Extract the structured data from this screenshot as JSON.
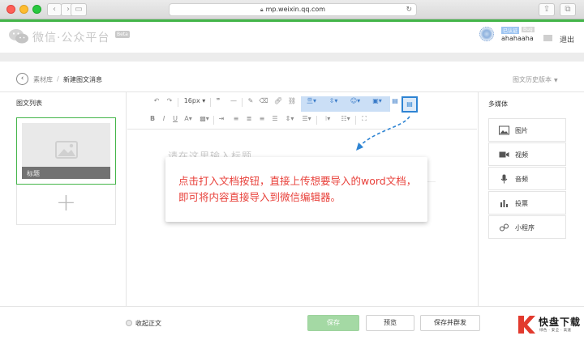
{
  "browser": {
    "url": "mp.weixin.qq.com"
  },
  "header": {
    "title": "微信·公众平台",
    "beta": "Beta",
    "account_name": "ahahaaha",
    "account_badge_1": "已认证",
    "account_badge_2": "Bug",
    "logout_label": "退出"
  },
  "breadcrumb": {
    "library": "素材库",
    "separator": "/",
    "current": "新建图文消息",
    "history_label": "图文历史版本"
  },
  "article_list": {
    "title": "图文列表",
    "items": [
      {
        "title": "标题"
      }
    ],
    "add_symbol": "+"
  },
  "toolbar": {
    "font_size": "16px",
    "doc_import_tooltip": "打入文档"
  },
  "editor": {
    "title_placeholder": "请在这里输入标题"
  },
  "media": {
    "title": "多媒体",
    "items": [
      {
        "label": "图片",
        "icon": "image-icon"
      },
      {
        "label": "视频",
        "icon": "video-icon"
      },
      {
        "label": "音频",
        "icon": "mic-icon"
      },
      {
        "label": "投票",
        "icon": "vote-icon"
      },
      {
        "label": "小程序",
        "icon": "miniprogram-icon"
      }
    ]
  },
  "footer": {
    "fold_label": "收起正文",
    "save_label": "保存",
    "preview_label": "预览",
    "send_label": "保存并群发"
  },
  "overlay": {
    "text": "点击打入文档按钮，直接上传想要导入的word文档，即可将内容直接导入到微信编辑器。"
  },
  "watermark": {
    "text": "快盘下载",
    "sub": "绿色 · 安全 · 高速"
  },
  "colors": {
    "accent_green": "#44b549",
    "highlight_blue": "#2e84d3",
    "tip_red": "#e8403a"
  }
}
